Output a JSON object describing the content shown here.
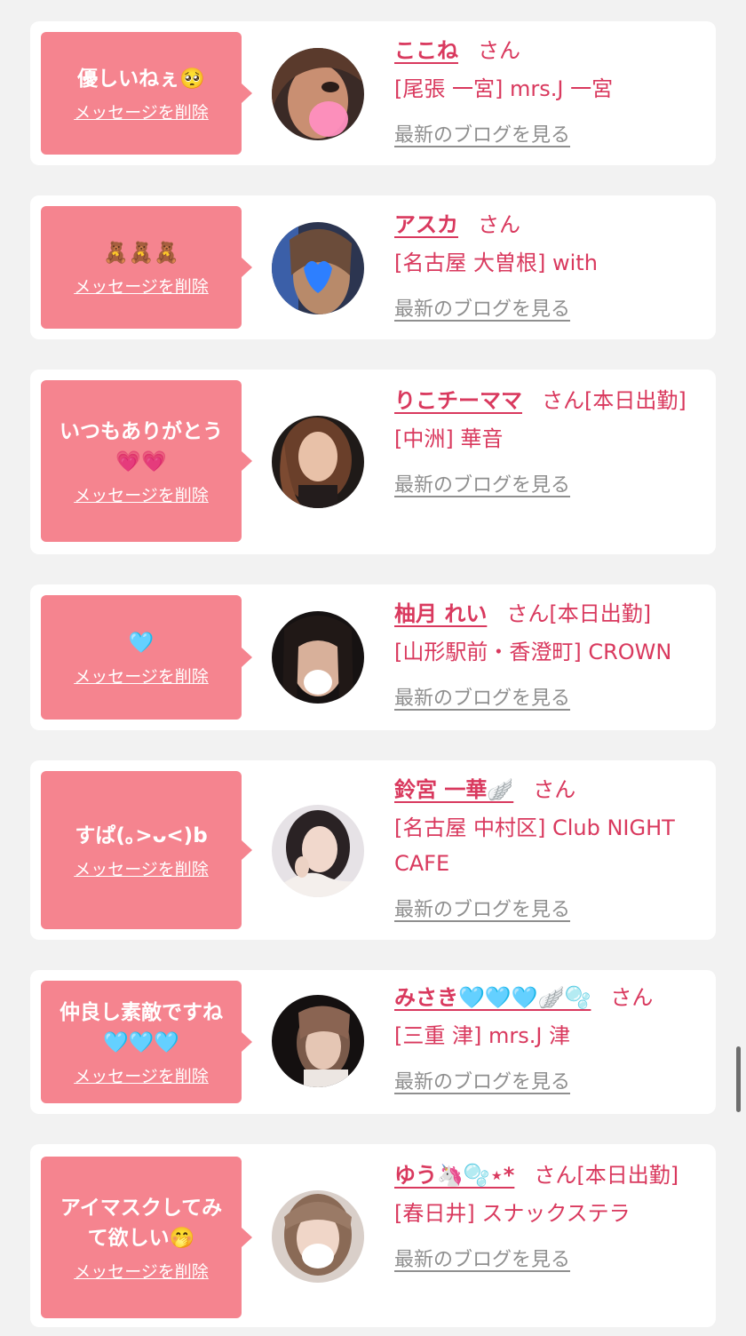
{
  "messages": [
    {
      "bubble_text": "優しいねぇ🥺",
      "delete_label": "メッセージを削除",
      "name": "ここね",
      "san": "さん",
      "shop": "[尾張 一宮] mrs.J 一宮",
      "blog_label": "最新のブログを見る"
    },
    {
      "bubble_text": "🧸🧸🧸",
      "delete_label": "メッセージを削除",
      "name": "アスカ",
      "san": "さん",
      "shop": "[名古屋 大曽根] with",
      "blog_label": "最新のブログを見る"
    },
    {
      "bubble_text": "いつもありがとう\n💗💗",
      "delete_label": "メッセージを削除",
      "name": "りこチーママ",
      "san": "さん[本日出勤]",
      "shop": "[中洲] 華音",
      "blog_label": "最新のブログを見る"
    },
    {
      "bubble_text": "🩵",
      "delete_label": "メッセージを削除",
      "name": "柚月 れい",
      "san": "さん[本日出勤]",
      "shop": "[山形駅前・香澄町] CROWN",
      "blog_label": "最新のブログを見る"
    },
    {
      "bubble_text": "すぱ(｡>ᴗ<)b",
      "delete_label": "メッセージを削除",
      "name": "鈴宮 一華🪽",
      "san": "さん",
      "shop": "[名古屋 中村区] Club NIGHT CAFE",
      "blog_label": "最新のブログを見る"
    },
    {
      "bubble_text": "仲良し素敵ですね\n🩵🩵🩵",
      "delete_label": "メッセージを削除",
      "name": "みさき🩵🩵🩵🪽🫧",
      "san": "さん",
      "shop": "[三重 津] mrs.J 津",
      "blog_label": "最新のブログを見る"
    },
    {
      "bubble_text": "アイマスクしてみ\nて欲しい🤭",
      "delete_label": "メッセージを削除",
      "name": "ゆう🦄🫧⋆*",
      "san": "さん[本日出勤]",
      "shop": "[春日井] スナックステラ",
      "blog_label": "最新のブログを見る"
    }
  ],
  "colors": {
    "bubble": "#f5848f",
    "name": "#d9395e",
    "link_gray": "#8f8f8f",
    "background": "#f2f2f2"
  }
}
